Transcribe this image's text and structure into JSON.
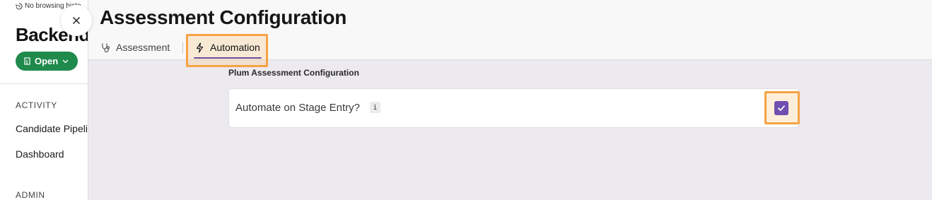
{
  "background": {
    "history_note": "No browsing histo",
    "title": "Backend",
    "status_label": "Open",
    "sections": [
      {
        "label": "ACTIVITY",
        "items": [
          "Candidate Pipeline",
          "Dashboard"
        ]
      },
      {
        "label": "ADMIN",
        "items": []
      }
    ]
  },
  "drawer": {
    "title": "Assessment Configuration",
    "tabs": [
      {
        "label": "Assessment",
        "icon": "stethoscope-icon",
        "active": false
      },
      {
        "label": "Automation",
        "icon": "lightning-icon",
        "active": true
      }
    ],
    "section_title": "Plum Assessment Configuration",
    "setting": {
      "label": "Automate on Stage Entry?",
      "info": "i",
      "checked": true
    }
  },
  "colors": {
    "accent": "#6f4fb0",
    "status_green": "#1f8a4c",
    "highlight": "#f5a345"
  }
}
